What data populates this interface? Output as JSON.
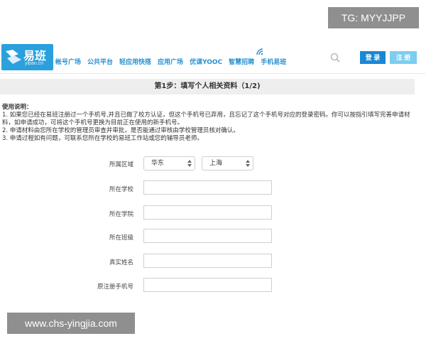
{
  "watermark_top": "TG: MYYJJPP",
  "watermark_bottom": "www.chs-yingjia.com",
  "logo": {
    "brand": "易班",
    "domain": "yiban.cn"
  },
  "nav": [
    "帐号广场",
    "公共平台",
    "轻应用快搭",
    "应用广场",
    "优课YOOC",
    "智慧招聘",
    "手机易班"
  ],
  "header_buttons": {
    "login": "登 录",
    "register": "注 册"
  },
  "step_title": "第1步：填写个人相关资料（1/2)",
  "usage": {
    "title": "使用说明：",
    "lines": [
      "1. 如果您已经在易班注册过一个手机号,并且已做了校方认证，但这个手机号已弃用，且忘记了这个手机号对应的登录密码。你可以按指引填写完善申请材料，如申请成功，可将这个手机号更换为目前正在使用的新手机号。",
      "2. 申请材料由您所在学校的管理员审查并审批，是否能通过审核由学校管理员核对确认。",
      "3. 申请过程如有问题，可联系您所在学校的易班工作站或您的辅导员老师。"
    ]
  },
  "form": {
    "region_label": "所属区域",
    "region_selected": "华东",
    "city_selected": "上海",
    "school_label": "所在学校",
    "college_label": "所在学院",
    "class_label": "所在班级",
    "name_label": "真实姓名",
    "phone_label": "原注册手机号"
  },
  "colors": {
    "brand_blue": "#2aa0dd",
    "login_blue": "#1a87d6",
    "register_light": "#7ccdf0",
    "nav_blue": "#2a90d0"
  }
}
